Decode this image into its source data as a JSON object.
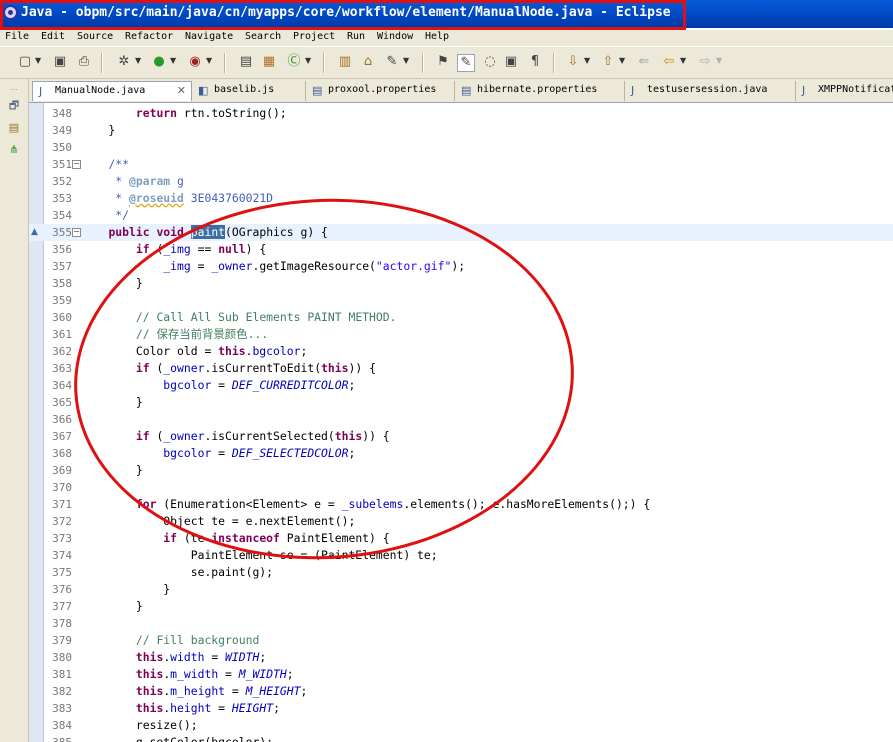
{
  "window": {
    "title": "Java - obpm/src/main/java/cn/myapps/core/workflow/element/ManualNode.java - Eclipse"
  },
  "menu": [
    "File",
    "Edit",
    "Source",
    "Refactor",
    "Navigate",
    "Search",
    "Project",
    "Run",
    "Window",
    "Help"
  ],
  "tabs": [
    {
      "label": "ManualNode.java",
      "icon": "java-file-icon",
      "active": true,
      "close": "✕"
    },
    {
      "label": "baselib.js",
      "icon": "js-file-icon",
      "active": false
    },
    {
      "label": "proxool.properties",
      "icon": "properties-file-icon",
      "active": false
    },
    {
      "label": "hibernate.properties",
      "icon": "properties-file-icon",
      "active": false
    },
    {
      "label": "testusersession.java",
      "icon": "java-file-icon",
      "active": false
    },
    {
      "label": "XMPPNotificat",
      "icon": "java-file-icon",
      "active": false
    }
  ],
  "editor": {
    "lines": [
      {
        "n": "348",
        "html": "        <span class='kw'>return</span> rtn.toString();"
      },
      {
        "n": "349",
        "html": "    }"
      },
      {
        "n": "350",
        "html": ""
      },
      {
        "n": "351",
        "html": "    <span class='jd'>/**</span>",
        "fold": "−"
      },
      {
        "n": "352",
        "html": "<span class='jd'>     * </span><span class='tag'>@param</span><span class='jd'> g</span>"
      },
      {
        "n": "353",
        "html": "<span class='jd'>     * </span><span class='tag squig'>@roseuid</span><span class='jd'> 3E043760021D</span>"
      },
      {
        "n": "354",
        "html": "<span class='jd'>     */</span>"
      },
      {
        "n": "355",
        "html": "    <span class='kw'>public</span> <span class='kw'>void</span> <span class='sel'>paint</span>(OGraphics g) {",
        "fold": "−",
        "current": true,
        "marker": true
      },
      {
        "n": "356",
        "html": "        <span class='kw'>if</span> (<span class='fld'>_img</span> == <span class='kw'>null</span>) {"
      },
      {
        "n": "357",
        "html": "            <span class='fld'>_img</span> = <span class='fld'>_owner</span>.getImageResource(<span class='str'>\"actor.gif\"</span>);"
      },
      {
        "n": "358",
        "html": "        }"
      },
      {
        "n": "359",
        "html": ""
      },
      {
        "n": "360",
        "html": "        <span class='cm'>// Call All Sub Elements PAINT METHOD.</span>"
      },
      {
        "n": "361",
        "html": "        <span class='cm'>// 保存当前背景颜色...</span>"
      },
      {
        "n": "362",
        "html": "        Color old = <span class='kw'>this</span>.<span class='fld'>bgcolor</span>;"
      },
      {
        "n": "363",
        "html": "        <span class='kw'>if</span> (<span class='fld'>_owner</span>.isCurrentToEdit(<span class='kw'>this</span>)) {"
      },
      {
        "n": "364",
        "html": "            <span class='fld'>bgcolor</span> = <span class='cst'>DEF_CURREDITCOLOR</span>;"
      },
      {
        "n": "365",
        "html": "        }"
      },
      {
        "n": "366",
        "html": ""
      },
      {
        "n": "367",
        "html": "        <span class='kw'>if</span> (<span class='fld'>_owner</span>.isCurrentSelected(<span class='kw'>this</span>)) {"
      },
      {
        "n": "368",
        "html": "            <span class='fld'>bgcolor</span> = <span class='cst'>DEF_SELECTEDCOLOR</span>;"
      },
      {
        "n": "369",
        "html": "        }"
      },
      {
        "n": "370",
        "html": ""
      },
      {
        "n": "371",
        "html": "        <span class='kw'>for</span> (Enumeration&lt;Element&gt; e = <span class='fld'>_subelems</span>.elements(); e.hasMoreElements();) {"
      },
      {
        "n": "372",
        "html": "            Object te = e.nextElement();"
      },
      {
        "n": "373",
        "html": "            <span class='kw'>if</span> (te <span class='kw'>instanceof</span> PaintElement) {"
      },
      {
        "n": "374",
        "html": "                PaintElement se = (PaintElement) te;"
      },
      {
        "n": "375",
        "html": "                se.paint(g);"
      },
      {
        "n": "376",
        "html": "            }"
      },
      {
        "n": "377",
        "html": "        }"
      },
      {
        "n": "378",
        "html": ""
      },
      {
        "n": "379",
        "html": "        <span class='cm'>// Fill background</span>"
      },
      {
        "n": "380",
        "html": "        <span class='kw'>this</span>.<span class='fld'>width</span> = <span class='cst'>WIDTH</span>;"
      },
      {
        "n": "381",
        "html": "        <span class='kw'>this</span>.<span class='fld'>m_width</span> = <span class='cst'>M_WIDTH</span>;"
      },
      {
        "n": "382",
        "html": "        <span class='kw'>this</span>.<span class='fld'>m_height</span> = <span class='cst'>M_HEIGHT</span>;"
      },
      {
        "n": "383",
        "html": "        <span class='kw'>this</span>.<span class='fld'>height</span> = <span class='cst'>HEIGHT</span>;"
      },
      {
        "n": "384",
        "html": "        resize();"
      },
      {
        "n": "385",
        "html": "        g.setColor(bgcolor);"
      }
    ]
  },
  "colors": {
    "highlight": "#e01010",
    "title_bar": "#0046c0",
    "selection": "#3a6ea5"
  }
}
